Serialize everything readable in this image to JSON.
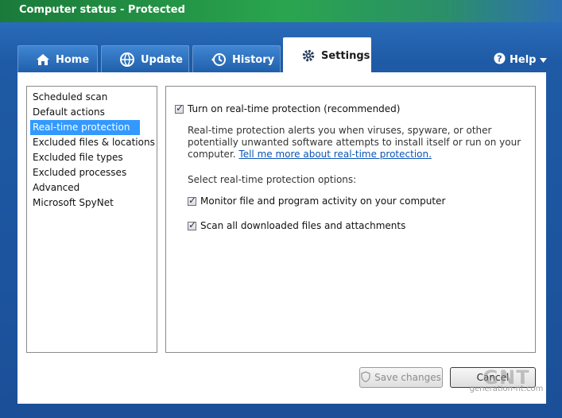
{
  "window": {
    "title": "Computer status - Protected"
  },
  "tabs": [
    {
      "label": "Home",
      "icon": "home-icon"
    },
    {
      "label": "Update",
      "icon": "globe-update-icon"
    },
    {
      "label": "History",
      "icon": "clock-history-icon"
    },
    {
      "label": "Settings",
      "icon": "gear-icon",
      "active": true
    }
  ],
  "help": {
    "label": "Help",
    "icon": "help-icon"
  },
  "sidebar": {
    "items": [
      {
        "label": "Scheduled scan"
      },
      {
        "label": "Default actions"
      },
      {
        "label": "Real-time protection",
        "selected": true
      },
      {
        "label": "Excluded files & locations"
      },
      {
        "label": "Excluded file types"
      },
      {
        "label": "Excluded processes"
      },
      {
        "label": "Advanced"
      },
      {
        "label": "Microsoft SpyNet"
      }
    ]
  },
  "settings": {
    "main_toggle": {
      "label": "Turn on real-time protection (recommended)",
      "checked": true
    },
    "description": "Real-time protection alerts you when viruses, spyware, or other potentially unwanted software attempts to install itself or run on your computer.",
    "link_text": "Tell me more about real-time protection.",
    "options_heading": "Select real-time protection options:",
    "options": [
      {
        "label": "Monitor file and program activity on your computer",
        "checked": true
      },
      {
        "label": "Scan all downloaded files and attachments",
        "checked": true
      }
    ]
  },
  "buttons": {
    "save": "Save changes",
    "cancel": "Cancel"
  },
  "watermark": {
    "big": "GNT",
    "small": "generation-nt.com"
  },
  "colors": {
    "titlebar": "#2aa54e",
    "window_bg": "#1e5aa5",
    "selection": "#3399ff",
    "link": "#0b55b5"
  }
}
